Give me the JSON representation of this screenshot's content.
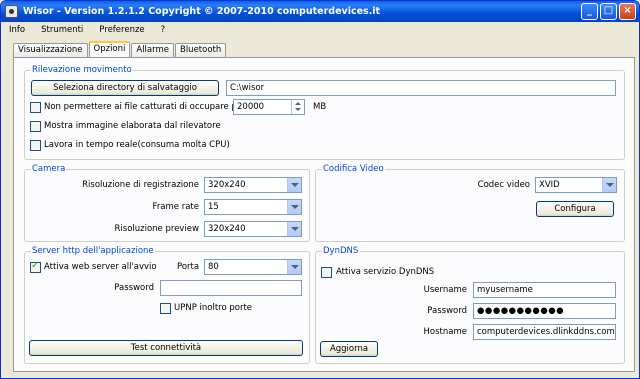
{
  "window": {
    "title": "Wisor - Version 1.2.1.2 Copyright © 2007-2010 computerdevices.it"
  },
  "menu": [
    "Info",
    "Strumenti",
    "Preferenze",
    "?"
  ],
  "tabs": [
    "Visualizzazione",
    "Opzioni",
    "Allarme",
    "Bluetooth"
  ],
  "motion": {
    "legend": "Rilevazione movimento",
    "select_dir_label": "Seleziona directory di salvataggio",
    "dir_value": "C:\\wisor",
    "limit_label": "Non permettere ai file catturati di occupare più di",
    "limit_value": "20000",
    "limit_unit": "MB",
    "show_image_label": "Mostra immagine elaborata dal rilevatore",
    "realtime_label": "Lavora in tempo reale(consuma molta CPU)",
    "limit_checked": false,
    "show_image_checked": false,
    "realtime_checked": false
  },
  "camera": {
    "legend": "Camera",
    "rec_res_label": "Risoluzione di registrazione",
    "rec_res_value": "320x240",
    "frame_rate_label": "Frame rate",
    "frame_rate_value": "15",
    "preview_res_label": "Risoluzione preview",
    "preview_res_value": "320x240"
  },
  "codec": {
    "legend": "Codifica Video",
    "codec_label": "Codec video",
    "codec_value": "XVID",
    "configure_label": "Configura"
  },
  "server": {
    "legend": "Server http dell'applicazione",
    "enable_label": "Attiva web server all'avvio",
    "enable_checked": true,
    "port_label": "Porta",
    "port_value": "80",
    "password_label": "Password",
    "password_value": "",
    "upnp_label": "UPNP inoltro porte",
    "upnp_checked": false,
    "test_label": "Test connettività"
  },
  "dyndns": {
    "legend": "DynDNS",
    "enable_label": "Attiva servizio DynDNS",
    "enable_checked": false,
    "username_label": "Username",
    "username_value": "myusername",
    "password_label": "Password",
    "password_value": "●●●●●●●●●●●",
    "hostname_label": "Hostname",
    "hostname_value": "computerdevices.dlinkddns.com",
    "update_label": "Aggiorna"
  }
}
